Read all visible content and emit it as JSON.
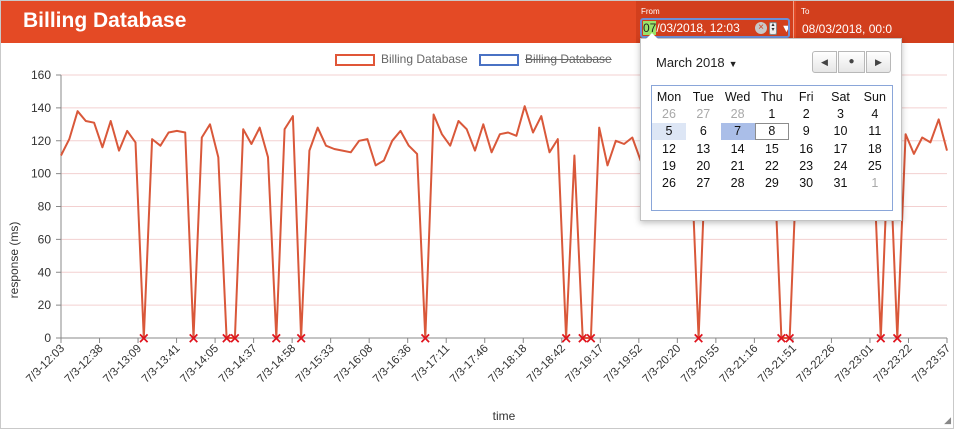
{
  "header": {
    "title": "Billing Database",
    "from_label": "From",
    "from_value_highlight": "07",
    "from_value_rest": "/03/2018, 12:03",
    "to_label": "To",
    "to_value": "08/03/2018, 00:0",
    "clear_glyph": "×",
    "dropdown_glyph": "▼"
  },
  "legend": {
    "items": [
      {
        "label": "Billing Database",
        "color": "#e05638",
        "hidden": false
      },
      {
        "label": "Billing Database",
        "color": "#4a72c4",
        "hidden": true
      }
    ]
  },
  "datepicker": {
    "month_label": "March 2018",
    "weekdays": [
      "Mon",
      "Tue",
      "Wed",
      "Thu",
      "Fri",
      "Sat",
      "Sun"
    ],
    "weeks": [
      [
        "26",
        "27",
        "28",
        "1",
        "2",
        "3",
        "4"
      ],
      [
        "5",
        "6",
        "7",
        "8",
        "9",
        "10",
        "11"
      ],
      [
        "12",
        "13",
        "14",
        "15",
        "16",
        "17",
        "18"
      ],
      [
        "19",
        "20",
        "21",
        "22",
        "23",
        "24",
        "25"
      ],
      [
        "26",
        "27",
        "28",
        "29",
        "30",
        "31",
        "1"
      ]
    ],
    "selected_day": "7",
    "current_day": "8",
    "highlighted_day": "5"
  },
  "chart_data": {
    "type": "line",
    "title": "",
    "xlabel": "time",
    "ylabel": "response (ms)",
    "ylim": [
      0,
      160
    ],
    "yticks": [
      0,
      20,
      40,
      60,
      80,
      100,
      120,
      140,
      160
    ],
    "xticks": [
      "7/3-12:03",
      "7/3-12:38",
      "7/3-13:09",
      "7/3-13:41",
      "7/3-14:05",
      "7/3-14:37",
      "7/3-14:58",
      "7/3-15:33",
      "7/3-16:08",
      "7/3-16:36",
      "7/3-17:11",
      "7/3-17:46",
      "7/3-18:18",
      "7/3-18:42",
      "7/3-19:17",
      "7/3-19:52",
      "7/3-20:20",
      "7/3-20:55",
      "7/3-21:16",
      "7/3-21:51",
      "7/3-22:26",
      "7/3-23:01",
      "7/3-23:22",
      "7/3-23:57"
    ],
    "grid": true,
    "series": [
      {
        "name": "Billing Database",
        "color": "#d9583a",
        "values": [
          111,
          121,
          138,
          132,
          131,
          116,
          132,
          114,
          126,
          119,
          0,
          121,
          117,
          125,
          126,
          125,
          0,
          122,
          130,
          110,
          0,
          0,
          127,
          118,
          128,
          110,
          0,
          127,
          135,
          0,
          114,
          128,
          117,
          115,
          114,
          113,
          120,
          121,
          105,
          108,
          120,
          126,
          117,
          112,
          0,
          136,
          124,
          117,
          132,
          127,
          114,
          130,
          113,
          124,
          125,
          123,
          141,
          125,
          135,
          113,
          121,
          0,
          111,
          0,
          0,
          128,
          105,
          120,
          118,
          122,
          108,
          105,
          127,
          112,
          117,
          123,
          122,
          0,
          130,
          128,
          125,
          122,
          120,
          124,
          126,
          121,
          123,
          0,
          0,
          125,
          124,
          120,
          118,
          124,
          122,
          127,
          124,
          121,
          123,
          0,
          126,
          0,
          124,
          112,
          122,
          119,
          133,
          114
        ]
      }
    ],
    "failure_marker": "×"
  }
}
